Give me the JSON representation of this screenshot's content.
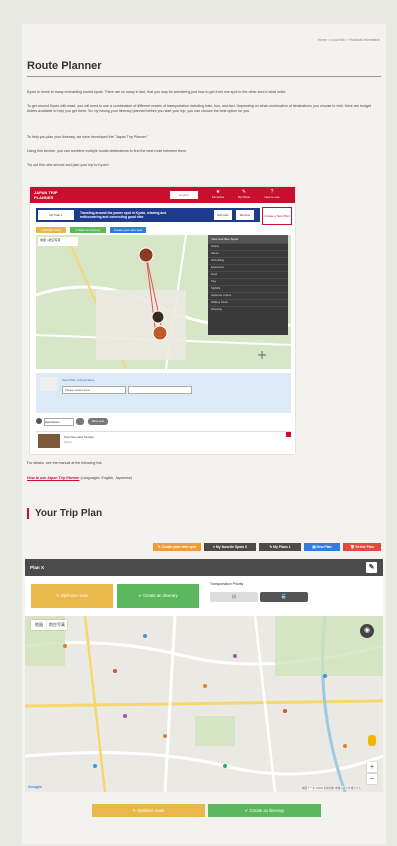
{
  "breadcrumb": "Home > Local Info > Practical Information",
  "page_title": "Route Planner",
  "paragraphs": [
    "Kyoto is home to many enchanting tourist spots. There are so many in fact, that you may be wondering just how to get from one spot to the other and in what order.",
    "To get around Kyoto with ease, you will need to use a combination of different modes of transportation including train, bus, and taxi. Depending on what combination of destinations you choose to visit, there are budget tickets available to help you get there. So, by having your itinerary planned before you start your trip, you can choose the best option for you.",
    "To help you plan your itinerary, we have developed the \"Japan Trip Planner.\"",
    "Using this service, you can combine multiple tourist destinations to find the best route between them.",
    "Try out this new service and plan your trip to Kyoto!"
  ],
  "screenshot": {
    "logo_line1": "JAPAN TRIP",
    "logo_line2": "PLANNER",
    "search": "English",
    "header_icons": [
      {
        "glyph": "★",
        "label": "Favorites"
      },
      {
        "glyph": "✎",
        "label": "My Plans"
      },
      {
        "glyph": "?",
        "label": "How to use"
      }
    ],
    "banner_btn": "My Plan 1",
    "banner_text": "Traveling around the power spot in Kyoto, relaxing and rediscovering and connecting good vibe",
    "banner_btn2": "Edit plan",
    "banner_btn3": "Remove",
    "create_btn": "Create a New Plan",
    "small_buttons": [
      "Optimize route",
      "Create an itinerary",
      "Create your own spot"
    ],
    "map_tabs": [
      "地図",
      "航空写真"
    ],
    "sidebar_header": "View and filter Spots",
    "sidebar_rows": [
      "History",
      "Nature",
      "Art/Crafting",
      "Experience",
      "Food",
      "Stay",
      "Nightlife",
      "Japanese Culture",
      "Walking Route",
      "Shopping"
    ],
    "spot_label": "View Plan: 3 Area Name",
    "select1": "Please select area",
    "select2": "",
    "row_select": "Date/Select",
    "row_btn": "Move spot",
    "item_name": "Kiyomizu-dera Temple",
    "item_sub": "Kyoto"
  },
  "manual_text": "For details, see the manual at the following link.",
  "manual_link": "How to use Japan Trip Planner",
  "manual_lang": " (Languages: English, Japanese)",
  "section_title": "Your Trip Plan",
  "trip_buttons": [
    {
      "label": "✎ Create your own spot",
      "color": "#f39c35"
    },
    {
      "label": "♥ My favorite Spots 0",
      "color": "#4b4b4b"
    },
    {
      "label": "✎ My Plans 1",
      "color": "#4b4b4b"
    },
    {
      "label": "▤ New Plan",
      "color": "#2f7de1"
    },
    {
      "label": "🗑 Delete Plan",
      "color": "#e8473d"
    }
  ],
  "plan_name": "Plan X",
  "optimize_label": "Optimize route",
  "itinerary_label": "Create an itinerary",
  "transport_label": "Transportation Priority",
  "toggle_left": "⊟",
  "toggle_right": "🚆",
  "map_tab_map": "地図",
  "map_tab_sat": "航空写真",
  "google_logo": "Google",
  "map_attrib": "地図データ ©2020  利用規約  地図の誤りを報告する",
  "bottom_optimize": "Optimize route",
  "bottom_itinerary": "Create an itinerary",
  "colors": {
    "accent": "#c8102e",
    "yellow": "#e8b84a",
    "green": "#5cb85c",
    "dark": "#4b4b4b"
  }
}
